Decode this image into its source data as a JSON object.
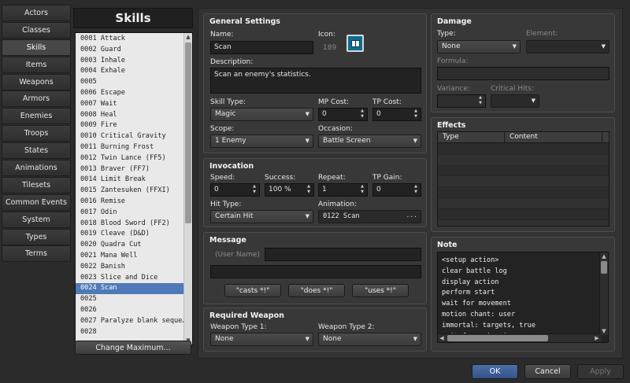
{
  "tabs": [
    "Actors",
    "Classes",
    "Skills",
    "Items",
    "Weapons",
    "Armors",
    "Enemies",
    "Troops",
    "States",
    "Animations",
    "Tilesets",
    "Common Events",
    "System",
    "Types",
    "Terms"
  ],
  "active_tab": 2,
  "list": {
    "title": "Skills",
    "items": [
      "0001 Attack",
      "0002 Guard",
      "0003 Inhale",
      "0004 Exhale",
      "0005",
      "0006 Escape",
      "0007 Wait",
      "0008 Heal",
      "0009 Fire",
      "0010 Critical Gravity",
      "0011 Burning Frost",
      "0012 Twin Lance (FF5)",
      "0013 Braver (FF7)",
      "0014 Limit Break",
      "0015 Zantesuken (FFXI)",
      "0016 Remise",
      "0017 Odin",
      "0018 Blood Sword (FF2)",
      "0019 Cleave (D&D)",
      "0020 Quadra Cut",
      "0021 Mana Well",
      "0022 Banish",
      "0023 Slice and Dice",
      "0024 Scan",
      "0025",
      "0026",
      "0027 Paralyze blank seque…",
      "0028"
    ],
    "selected": 23,
    "change_max_label": "Change Maximum..."
  },
  "general": {
    "title": "General Settings",
    "name_label": "Name:",
    "name_value": "Scan",
    "icon_label": "Icon:",
    "icon_index": "189",
    "icon_name": "book-icon",
    "desc_label": "Description:",
    "desc_value": "Scan an enemy's statistics.",
    "skill_type_label": "Skill Type:",
    "skill_type_value": "Magic",
    "mp_label": "MP Cost:",
    "mp_value": "0",
    "tp_label": "TP Cost:",
    "tp_value": "0",
    "scope_label": "Scope:",
    "scope_value": "1 Enemy",
    "occasion_label": "Occasion:",
    "occasion_value": "Battle Screen"
  },
  "invocation": {
    "title": "Invocation",
    "speed_label": "Speed:",
    "speed_value": "0",
    "success_label": "Success:",
    "success_value": "100 %",
    "repeat_label": "Repeat:",
    "repeat_value": "1",
    "tpgain_label": "TP Gain:",
    "tpgain_value": "0",
    "hit_label": "Hit Type:",
    "hit_value": "Certain Hit",
    "anim_label": "Animation:",
    "anim_value": "0122 Scan"
  },
  "message": {
    "title": "Message",
    "user_name_placeholder": "(User Name)",
    "buttons": [
      "\"casts *!\"",
      "\"does *!\"",
      "\"uses *!\""
    ]
  },
  "weapon": {
    "title": "Required Weapon",
    "type1_label": "Weapon Type 1:",
    "type1_value": "None",
    "type2_label": "Weapon Type 2:",
    "type2_value": "None"
  },
  "damage": {
    "title": "Damage",
    "type_label": "Type:",
    "type_value": "None",
    "element_label": "Element:",
    "formula_label": "Formula:",
    "variance_label": "Variance:",
    "crit_label": "Critical Hits:"
  },
  "effects": {
    "title": "Effects",
    "col_type": "Type",
    "col_content": "Content"
  },
  "note": {
    "title": "Note",
    "lines": [
      "<setup action>",
      "clear battle log",
      "display action",
      "perform start",
      "wait for movement",
      "motion chant: user",
      "immortal: targets, true",
      "wait for animation"
    ]
  },
  "footer": {
    "ok": "OK",
    "cancel": "Cancel",
    "apply": "Apply"
  }
}
